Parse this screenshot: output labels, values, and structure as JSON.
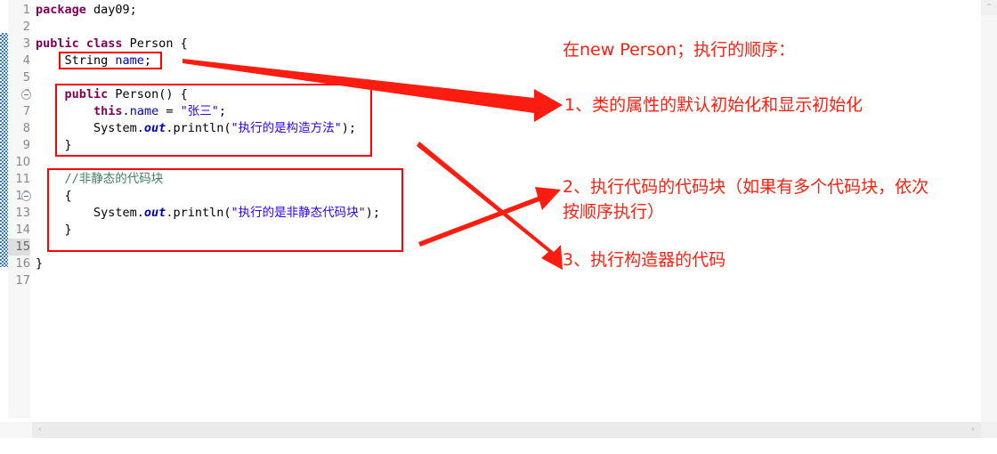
{
  "editor": {
    "line_numbers": [
      "1",
      "2",
      "3",
      "4",
      "5",
      "6",
      "7",
      "8",
      "9",
      "10",
      "11",
      "12",
      "13",
      "14",
      "15",
      "16",
      "17"
    ],
    "current_line": "17",
    "selected_gutter_line": "15",
    "fold_lines": [
      "6",
      "12"
    ],
    "lines": [
      {
        "n": "1",
        "tokens": [
          {
            "t": "package",
            "c": "kw"
          },
          {
            "t": " day09;",
            "c": "pl"
          }
        ]
      },
      {
        "n": "2",
        "tokens": []
      },
      {
        "n": "3",
        "tokens": [
          {
            "t": "public class",
            "c": "kw"
          },
          {
            "t": " Person {",
            "c": "pl"
          }
        ]
      },
      {
        "n": "4",
        "tokens": [
          {
            "t": "    String ",
            "c": "pl"
          },
          {
            "t": "name",
            "c": "fld"
          },
          {
            "t": ";",
            "c": "pl"
          }
        ]
      },
      {
        "n": "5",
        "tokens": []
      },
      {
        "n": "6",
        "tokens": [
          {
            "t": "    ",
            "c": "pl"
          },
          {
            "t": "public",
            "c": "kw"
          },
          {
            "t": " Person() {",
            "c": "pl"
          }
        ]
      },
      {
        "n": "7",
        "tokens": [
          {
            "t": "        ",
            "c": "pl"
          },
          {
            "t": "this",
            "c": "kw"
          },
          {
            "t": ".",
            "c": "pl"
          },
          {
            "t": "name",
            "c": "fld"
          },
          {
            "t": " = ",
            "c": "pl"
          },
          {
            "t": "\"张三\"",
            "c": "str"
          },
          {
            "t": ";",
            "c": "pl"
          }
        ]
      },
      {
        "n": "8",
        "tokens": [
          {
            "t": "        System.",
            "c": "pl"
          },
          {
            "t": "out",
            "c": "sfld"
          },
          {
            "t": ".println(",
            "c": "pl"
          },
          {
            "t": "\"执行的是构造方法\"",
            "c": "str"
          },
          {
            "t": ");",
            "c": "pl"
          }
        ]
      },
      {
        "n": "9",
        "tokens": [
          {
            "t": "    }",
            "c": "pl"
          }
        ]
      },
      {
        "n": "10",
        "tokens": []
      },
      {
        "n": "11",
        "tokens": [
          {
            "t": "    //非静态的代码块",
            "c": "cmt"
          }
        ]
      },
      {
        "n": "12",
        "tokens": [
          {
            "t": "    {",
            "c": "pl"
          }
        ]
      },
      {
        "n": "13",
        "tokens": [
          {
            "t": "        System.",
            "c": "pl"
          },
          {
            "t": "out",
            "c": "sfld"
          },
          {
            "t": ".println(",
            "c": "pl"
          },
          {
            "t": "\"执行的是非静态代码块\"",
            "c": "str"
          },
          {
            "t": ");",
            "c": "pl"
          }
        ]
      },
      {
        "n": "14",
        "tokens": [
          {
            "t": "    }",
            "c": "pl"
          }
        ]
      },
      {
        "n": "15",
        "tokens": []
      },
      {
        "n": "16",
        "tokens": [
          {
            "t": "}",
            "c": "pl"
          }
        ]
      },
      {
        "n": "17",
        "tokens": []
      }
    ]
  },
  "annotations": {
    "title": "在new Person；执行的顺序：",
    "step1": "1、类的属性的默认初始化和显示初始化",
    "step2_line1": "2、执行代码的代码块（如果有多个代码块，依次",
    "step2_line2": "按顺序执行）",
    "step3": "3、执行构造器的代码",
    "color": "#fe2012"
  },
  "highlight_boxes": [
    {
      "name": "field-declaration-box"
    },
    {
      "name": "constructor-box"
    },
    {
      "name": "instance-initializer-box"
    }
  ],
  "scrollbars": {
    "up_arrow": "⌃",
    "down_arrow": "⌄",
    "left_arrow": "‹",
    "right_arrow": "›"
  }
}
